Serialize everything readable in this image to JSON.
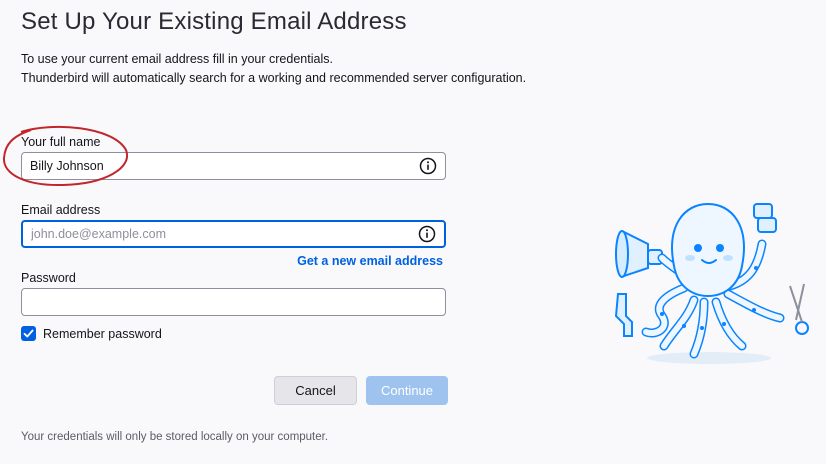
{
  "page": {
    "title": "Set Up Your Existing Email Address",
    "description_line1": "To use your current email address fill in your credentials.",
    "description_line2": "Thunderbird will automatically search for a working and recommended server configuration."
  },
  "form": {
    "full_name": {
      "label": "Your full name",
      "value": "Billy Johnson"
    },
    "email": {
      "label": "Email address",
      "value": "",
      "placeholder": "john.doe@example.com"
    },
    "get_new_email_link": "Get a new email address",
    "password": {
      "label": "Password",
      "value": ""
    },
    "remember_password": {
      "label": "Remember password",
      "checked": true
    }
  },
  "buttons": {
    "cancel": "Cancel",
    "continue": "Continue"
  },
  "footer": "Your credentials will only be stored locally on your computer.",
  "colors": {
    "accent": "#0061e0",
    "continue_disabled": "#9fc3ef",
    "annotation": "#c0262c",
    "background": "#f9f9fb"
  },
  "icons": {
    "info": "info-icon",
    "check": "checkmark-icon",
    "mascot": "thunderbird-octopus-illustration"
  }
}
